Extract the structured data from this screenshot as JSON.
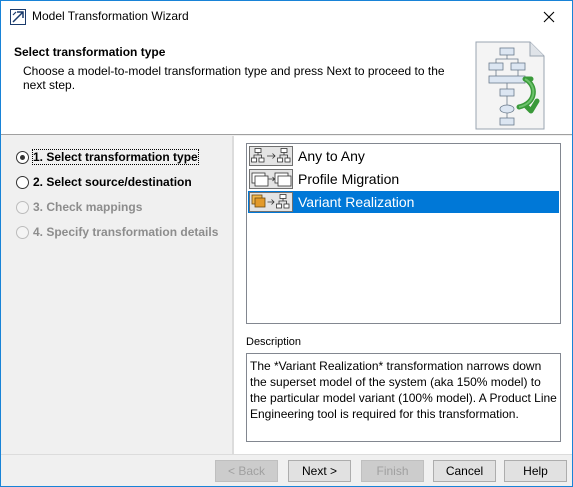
{
  "window": {
    "title": "Model Transformation Wizard"
  },
  "header": {
    "title": "Select transformation type",
    "description": "Choose a model-to-model transformation type and press Next to proceed to the next step."
  },
  "steps": [
    {
      "label": "1. Select transformation type",
      "state": "current"
    },
    {
      "label": "2. Select source/destination",
      "state": "enabled"
    },
    {
      "label": "3. Check mappings",
      "state": "disabled"
    },
    {
      "label": "4. Specify transformation details",
      "state": "disabled"
    }
  ],
  "transformation_types": [
    {
      "label": "Any to Any",
      "icon": "any-to-any-icon",
      "selected": false
    },
    {
      "label": "Profile Migration",
      "icon": "profile-migration-icon",
      "selected": false
    },
    {
      "label": "Variant Realization",
      "icon": "variant-realization-icon",
      "selected": true
    }
  ],
  "description": {
    "label": "Description",
    "text": "The *Variant Realization* transformation narrows down the superset model of the system (aka 150% model) to the particular model variant (100% model). A Product Line Engineering tool is required for this transformation."
  },
  "buttons": {
    "back": "< Back",
    "next": "Next >",
    "finish": "Finish",
    "cancel": "Cancel",
    "help": "Help"
  },
  "colors": {
    "accent": "#0078d7",
    "window_border": "#1883d7",
    "disabled_text": "#8d8d8d"
  }
}
